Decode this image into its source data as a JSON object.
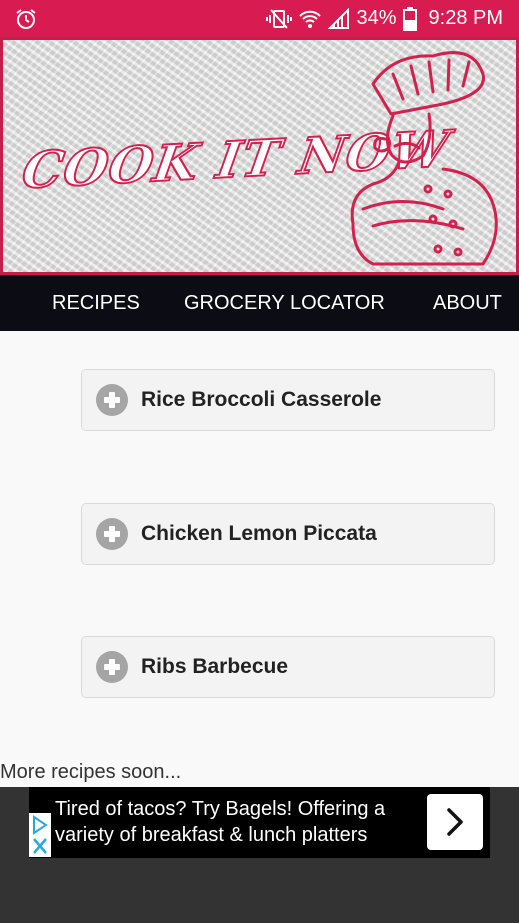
{
  "status_bar": {
    "battery_percent": "34%",
    "time": "9:28 PM",
    "icons": [
      "alarm-icon",
      "vibrate-mute-icon",
      "wifi-icon",
      "signal-icon",
      "battery-icon"
    ]
  },
  "banner": {
    "title": "COOK IT NOW"
  },
  "nav": {
    "items": [
      {
        "label": "RECIPES"
      },
      {
        "label": "GROCERY LOCATOR"
      },
      {
        "label": "ABOUT"
      }
    ]
  },
  "recipes": [
    {
      "label": "Rice Broccoli Casserole",
      "icon": "plus-circle-icon"
    },
    {
      "label": "Chicken Lemon Piccata",
      "icon": "plus-circle-icon"
    },
    {
      "label": "Ribs Barbecue",
      "icon": "plus-circle-icon"
    }
  ],
  "more_text": "More recipes soon...",
  "ad": {
    "text": "Tired of tacos? Try Bagels! Offering a variety of breakfast & lunch platters",
    "cta_icon": "chevron-right-icon"
  },
  "colors": {
    "accent": "#d81b50",
    "nav_background": "#0c0c14",
    "content_background": "#f9f9f9"
  }
}
